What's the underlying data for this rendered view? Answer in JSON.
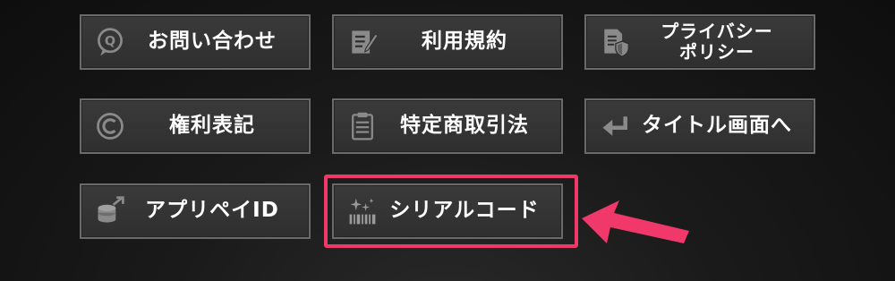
{
  "menu": {
    "buttons": [
      {
        "label": "お問い合わせ",
        "icon": "question-bubble-icon"
      },
      {
        "label": "利用規約",
        "icon": "document-pen-icon"
      },
      {
        "label": "プライバシー\nポリシー",
        "icon": "document-shield-icon"
      },
      {
        "label": "権利表記",
        "icon": "copyright-icon"
      },
      {
        "label": "特定商取引法",
        "icon": "clipboard-list-icon"
      },
      {
        "label": "タイトル画面へ",
        "icon": "return-arrow-icon"
      },
      {
        "label": "アプリペイID",
        "icon": "coins-arrow-icon"
      },
      {
        "label": "シリアルコード",
        "icon": "sparkle-barcode-icon"
      }
    ]
  },
  "annotation": {
    "highlight_color": "#f0386b",
    "highlighted_item": "シリアルコード"
  }
}
